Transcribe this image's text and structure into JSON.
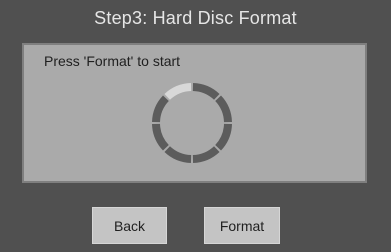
{
  "window": {
    "title": "Step3: Hard Disc Format"
  },
  "panel": {
    "prompt": "Press 'Format' to start"
  },
  "progress_ring": {
    "segments_total": 8,
    "segments_highlighted": 1,
    "color_dark": "#5c5c5c",
    "color_light": "#d8d8d8"
  },
  "buttons": {
    "back_label": "Back",
    "format_label": "Format"
  },
  "colors": {
    "background": "#505050",
    "panel": "#aaaaaa",
    "button": "#c4c4c4"
  }
}
